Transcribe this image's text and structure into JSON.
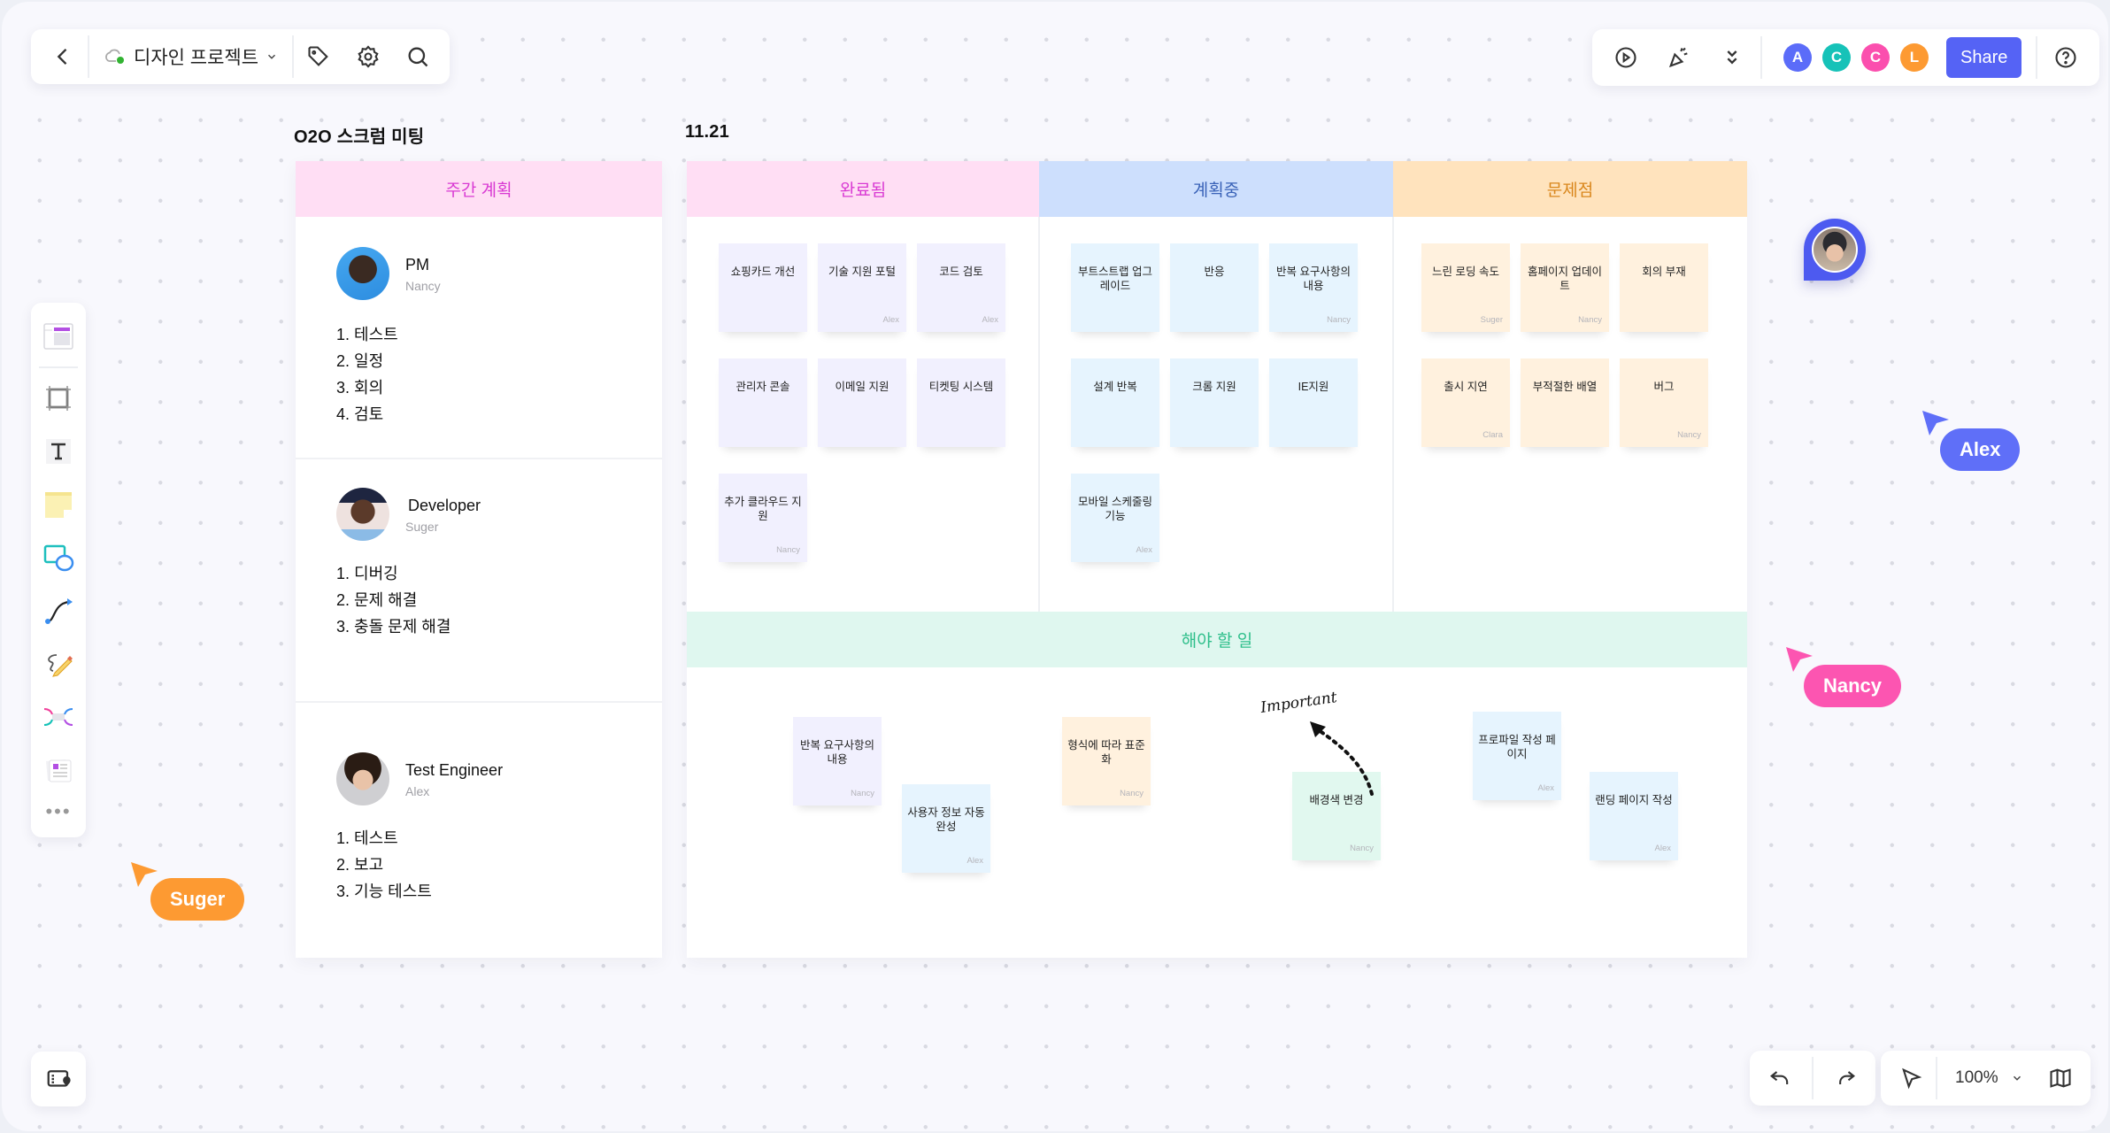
{
  "toolbar": {
    "back_icon": "chevron-left-icon",
    "project_name": "디자인 프로젝트",
    "sync_status": "synced",
    "actions": [
      "tag-icon",
      "settings-icon",
      "search-icon"
    ]
  },
  "topright": {
    "actions": [
      "present-play-icon",
      "celebrate-icon",
      "more-chevrons-icon"
    ],
    "collaborators": [
      {
        "initial": "A",
        "color": "#5b6cf9"
      },
      {
        "initial": "C",
        "color": "#16c2b8"
      },
      {
        "initial": "C",
        "color": "#fb4fae"
      },
      {
        "initial": "L",
        "color": "#fd9a32"
      }
    ],
    "share_label": "Share",
    "help_icon": "help-icon"
  },
  "tools": [
    "template-icon",
    "frame-icon",
    "text-icon",
    "sticky-note-icon",
    "shape-icon",
    "connector-icon",
    "pen-icon",
    "mindmap-icon",
    "card-icon",
    "more-icon"
  ],
  "bottom": {
    "zoom": "100%",
    "actions": [
      "undo-icon",
      "redo-icon",
      "select-icon",
      "minimap-icon"
    ],
    "left_action": "outline-map-icon"
  },
  "board": {
    "title": "O2O 스크럼 미팅",
    "date": "11.21",
    "weekly": {
      "header": "주간 계획",
      "header_bg": "#ffdef4",
      "header_fg": "#d93ad3",
      "people": [
        {
          "role": "PM",
          "name": "Nancy",
          "tasks": [
            "1. 테스트",
            "2. 일정",
            "3. 회의",
            "4. 검토"
          ]
        },
        {
          "role": "Developer",
          "name": "Suger",
          "tasks": [
            "1. 디버깅",
            "2. 문제 해결",
            "3. 충돌 문제 해결"
          ]
        },
        {
          "role": "Test Engineer",
          "name": "Alex",
          "tasks": [
            "1. 테스트",
            "2. 보고",
            "3. 기능 테스트"
          ]
        }
      ]
    },
    "columns": [
      {
        "title": "완료됨",
        "bg": "#ffdef4",
        "fg": "#d93ad3",
        "note_bg": "#f1f0fe",
        "notes": [
          {
            "text": "쇼핑카드 개선",
            "owner": ""
          },
          {
            "text": "기술 지원 포털",
            "owner": "Alex"
          },
          {
            "text": "코드 검토",
            "owner": "Alex"
          },
          {
            "text": "관리자 콘솔",
            "owner": ""
          },
          {
            "text": "이메일 지원",
            "owner": ""
          },
          {
            "text": "티켓팅 시스템",
            "owner": ""
          },
          {
            "text": "추가 클라우드 지원",
            "owner": "Nancy"
          }
        ]
      },
      {
        "title": "계획중",
        "bg": "#cddffd",
        "fg": "#3a63b8",
        "note_bg": "#e6f4fe",
        "notes": [
          {
            "text": "부트스트랩 업그레이드",
            "owner": ""
          },
          {
            "text": "반응",
            "owner": ""
          },
          {
            "text": "반복 요구사항의 내용",
            "owner": "Nancy"
          },
          {
            "text": "설계 반복",
            "owner": ""
          },
          {
            "text": "크롬 지원",
            "owner": ""
          },
          {
            "text": "IE지원",
            "owner": ""
          },
          {
            "text": "모바일 스케줄링 기능",
            "owner": "Alex"
          }
        ]
      },
      {
        "title": "문제점",
        "bg": "#ffe3bd",
        "fg": "#d9861b",
        "note_bg": "#fff1de",
        "notes": [
          {
            "text": "느린 로딩 속도",
            "owner": "Suger"
          },
          {
            "text": "홈페이지 업데이트",
            "owner": "Nancy"
          },
          {
            "text": "회의 부재",
            "owner": ""
          },
          {
            "text": "출시 지연",
            "owner": "Clara"
          },
          {
            "text": "부적절한 배열",
            "owner": ""
          },
          {
            "text": "버그",
            "owner": "Nancy"
          }
        ]
      }
    ],
    "todo": {
      "title": "해야 할 일",
      "notes": [
        {
          "text": "반복 요구사항의 내용",
          "owner": "Nancy",
          "bg": "#f1f0fe"
        },
        {
          "text": "사용자 정보 자동 완성",
          "owner": "Alex",
          "bg": "#e6f4fe"
        },
        {
          "text": "형식에 따라 표준화",
          "owner": "Nancy",
          "bg": "#fff1de"
        },
        {
          "text": "배경색 변경",
          "owner": "Nancy",
          "bg": "#e1f8ef"
        },
        {
          "text": "프로파일 작성 페이지",
          "owner": "Alex",
          "bg": "#e6f4fe"
        },
        {
          "text": "랜딩 페이지 작성",
          "owner": "Alex",
          "bg": "#e6f4fe"
        }
      ],
      "annotation": "Important"
    }
  },
  "cursors": [
    {
      "name": "Alex",
      "color": "#5f6ff8"
    },
    {
      "name": "Nancy",
      "color": "#fc55b1"
    },
    {
      "name": "Suger",
      "color": "#fd9a32"
    }
  ]
}
